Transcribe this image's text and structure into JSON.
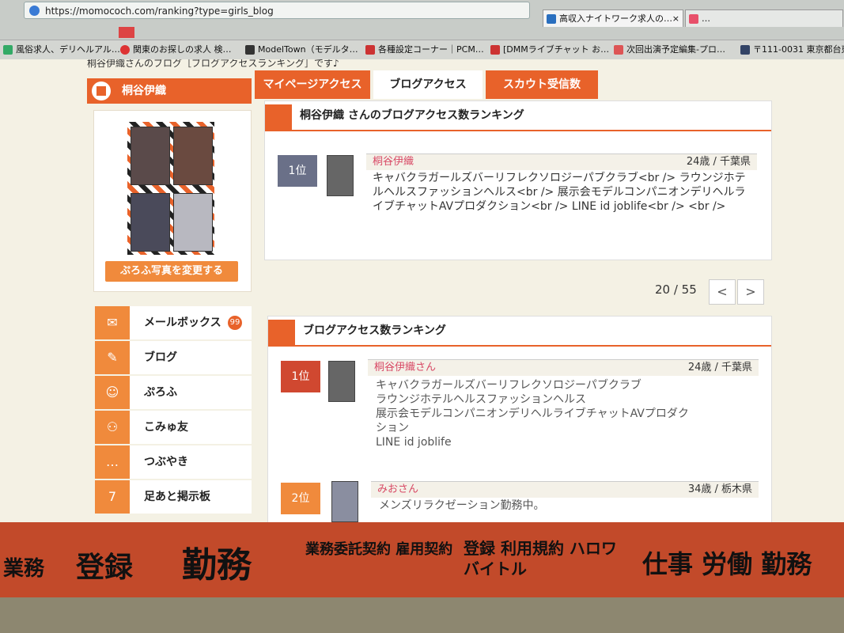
{
  "browser": {
    "url": "https://momococh.com/ranking?type=girls_blog",
    "tabs": [
      {
        "label": "高収入ナイトワーク求人の…",
        "close": "×"
      },
      {
        "label": "…"
      }
    ],
    "bookmarks": [
      "風俗求人、デリヘルアル…",
      "関東のお探しの求人 検…",
      "ModelTown（モデルタ…",
      "各種設定コーナー｜PCM…",
      "[DMMライブチャット お…",
      "次回出演予定編集-プロ…",
      "〒111-0031 東京都台東…"
    ]
  },
  "page": {
    "peek_text": "桐谷伊織さんのブログ［ブログアクセスランキング］です♪",
    "user_name": "桐谷伊織",
    "change_photo_label": "ぷろふ写真を変更する",
    "tabs": [
      "マイページアクセス",
      "ブログアクセス",
      "スカウト受信数"
    ],
    "personal_ranking": {
      "title": "桐谷伊織 さんのブログアクセス数ランキング",
      "entry": {
        "rank": "1位",
        "name": "桐谷伊織",
        "info": "24歳 / 千葉県",
        "desc": "キャバクラガールズバーリフレクソロジーパブクラブ<br /> ラウンジホテルヘルスファッションヘルス<br /> 展示会モデルコンパニオンデリヘルライブチャットAVプロダクション<br /> LINE id joblife<br /> <br />"
      }
    },
    "pager": {
      "text": "20 / 55",
      "prev": "<",
      "next": ">"
    },
    "ranking": {
      "title": "ブログアクセス数ランキング",
      "entries": [
        {
          "rank": "1位",
          "name": "桐谷伊織",
          "suffix": "さん",
          "info": "24歳 / 千葉県",
          "lines": [
            "キャバクラガールズバーリフレクソロジーパブクラブ",
            "ラウンジホテルヘルスファッションヘルス",
            "展示会モデルコンパニオンデリヘルライブチャットAVプロダク",
            "ション",
            "LINE id joblife"
          ]
        },
        {
          "rank": "2位",
          "name": "みお",
          "suffix": "さん",
          "info": "34歳 / 栃木県",
          "lines": [
            "メンズリラクゼーション勤務中。"
          ]
        }
      ]
    },
    "menu": [
      {
        "label": "メールボックス",
        "icon": "mail-icon",
        "badge": "99"
      },
      {
        "label": "ブログ",
        "icon": "edit-icon"
      },
      {
        "label": "ぷろふ",
        "icon": "profile-icon"
      },
      {
        "label": "こみゅ友",
        "icon": "friends-icon"
      },
      {
        "label": "つぶやき",
        "icon": "chat-icon"
      },
      {
        "label": "足あと掲示板",
        "icon": "footprint-icon"
      }
    ]
  },
  "handwriting": [
    "業務",
    "登録",
    "勤務",
    "業務委託契約 雇用契約",
    "登録 利用規約 ハロワ バイトル",
    "仕事 労働 勤務"
  ]
}
